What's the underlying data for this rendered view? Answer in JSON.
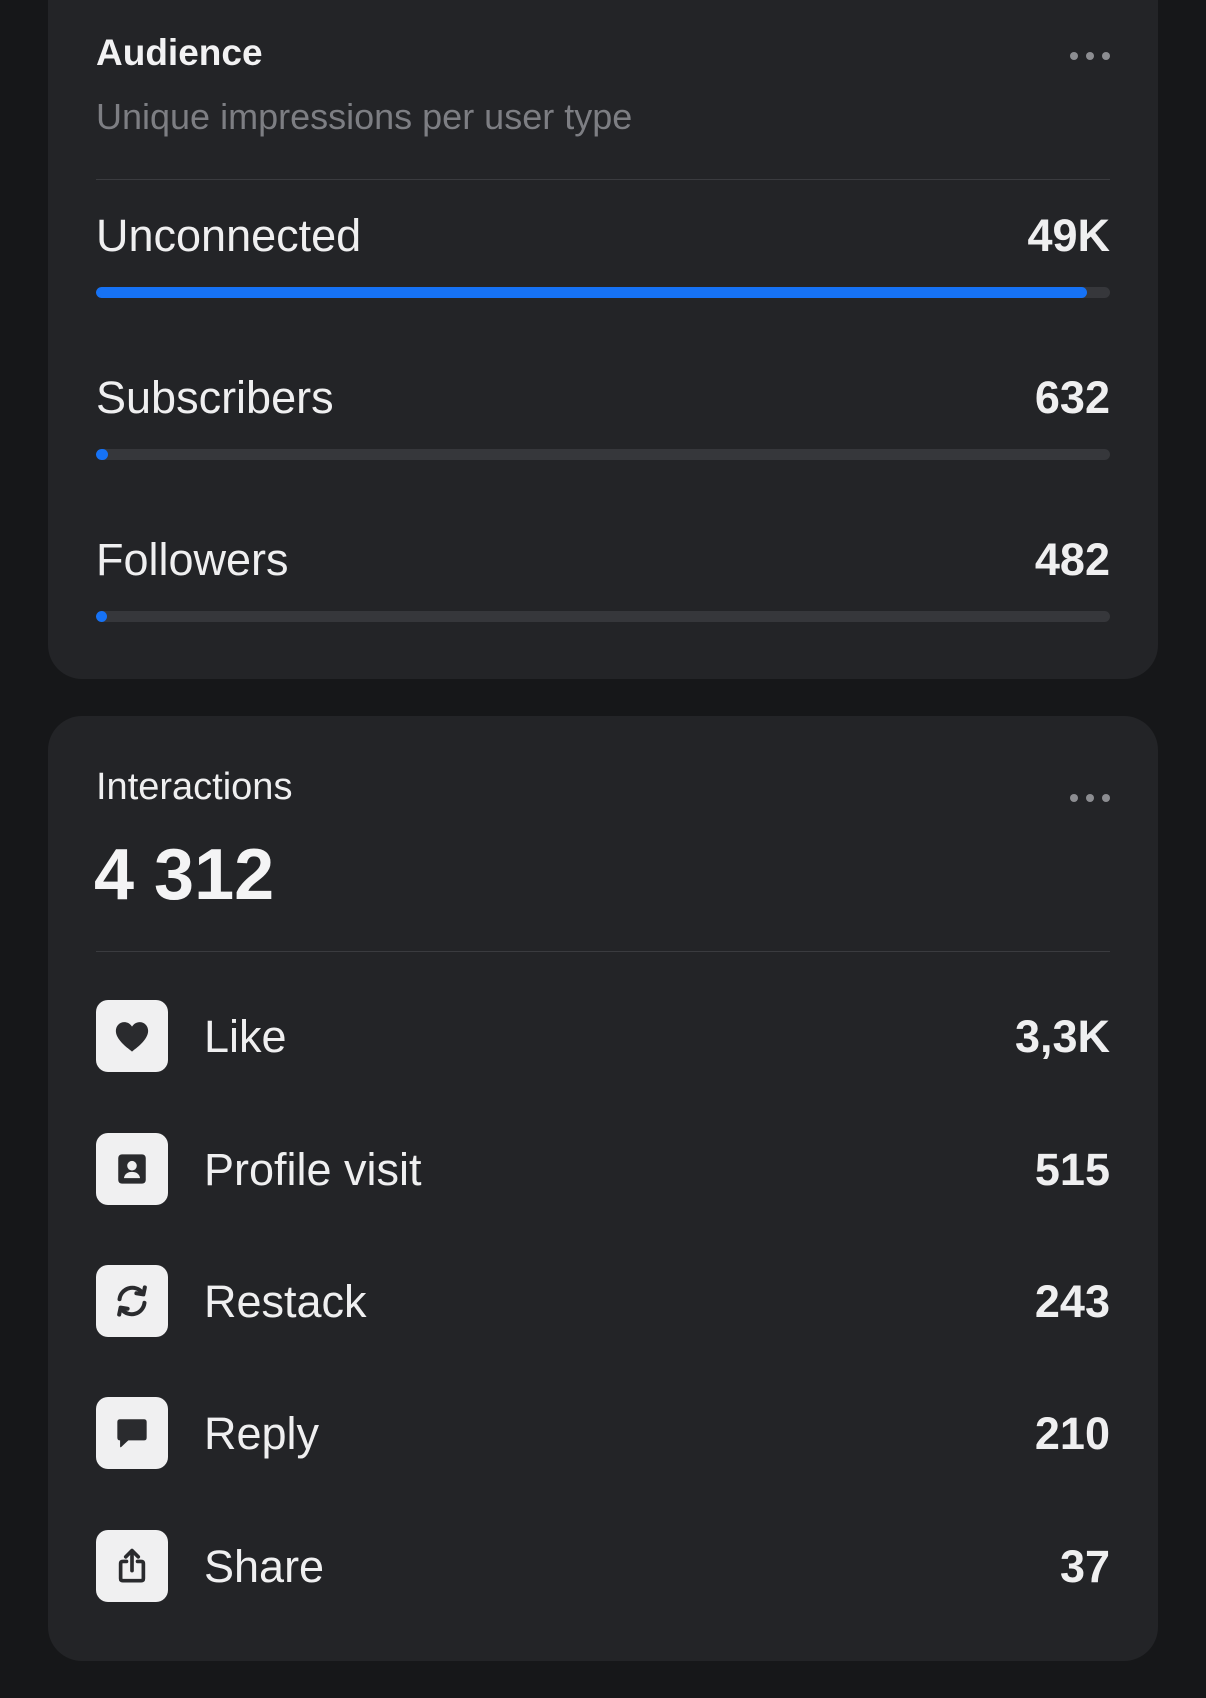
{
  "audience": {
    "title": "Audience",
    "subtitle": "Unique impressions per user type",
    "rows": [
      {
        "label": "Unconnected",
        "value": "49K",
        "fraction": 0.977
      },
      {
        "label": "Subscribers",
        "value": "632",
        "fraction": 0.012
      },
      {
        "label": "Followers",
        "value": "482",
        "fraction": 0.009
      }
    ],
    "accent_color": "#1672F5"
  },
  "interactions": {
    "title": "Interactions",
    "total": "4 312",
    "rows": [
      {
        "icon": "heart-icon",
        "label": "Like",
        "value": "3,3K"
      },
      {
        "icon": "profile-icon",
        "label": "Profile visit",
        "value": "515"
      },
      {
        "icon": "restack-icon",
        "label": "Restack",
        "value": "243"
      },
      {
        "icon": "comment-icon",
        "label": "Reply",
        "value": "210"
      },
      {
        "icon": "share-icon",
        "label": "Share",
        "value": "37"
      }
    ]
  }
}
